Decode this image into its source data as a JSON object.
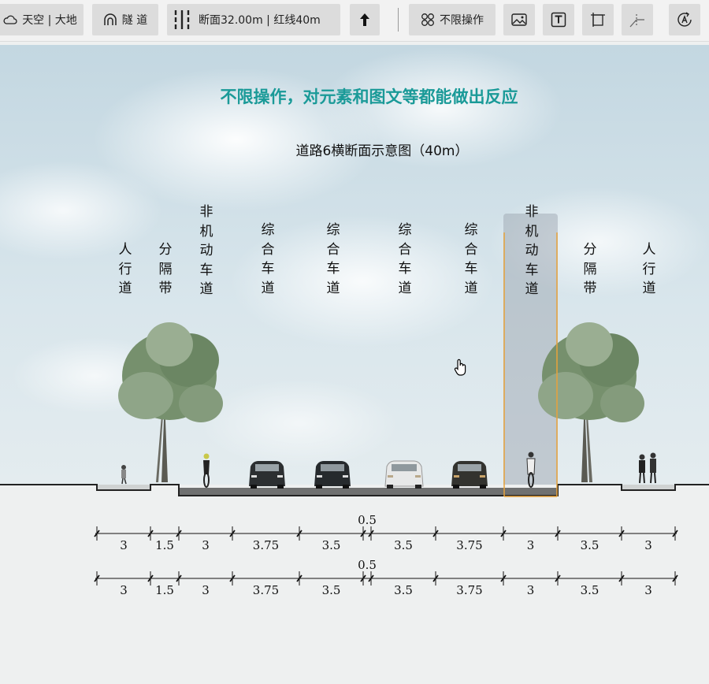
{
  "toolbar": {
    "sky_ground": "天空 | 大地",
    "tunnel": "隧 道",
    "section": "断面32.00m  |   红线40m",
    "unlimited": "不限操作"
  },
  "headline": "不限操作，对元素和图文等都能做出反应",
  "diagram_title": "道路6横断面示意图（40m）",
  "lanes": [
    {
      "label": "人行道",
      "width": "3"
    },
    {
      "label": "分隔带",
      "width": "1.5"
    },
    {
      "label": "非机动车道",
      "width": "3"
    },
    {
      "label": "综合车道",
      "width": "3.75"
    },
    {
      "label": "综合车道",
      "width": "3.5"
    },
    {
      "label": "综合车道",
      "width": "3.5"
    },
    {
      "label": "综合车道",
      "width": "3.75"
    },
    {
      "label": "非机动车道",
      "width": "3"
    },
    {
      "label": "分隔带",
      "width": "3.5"
    },
    {
      "label": "人行道",
      "width": "3"
    }
  ],
  "median_width": "0.5",
  "colors": {
    "accent": "#1a9a98",
    "highlight_border": "#e8a23a"
  }
}
